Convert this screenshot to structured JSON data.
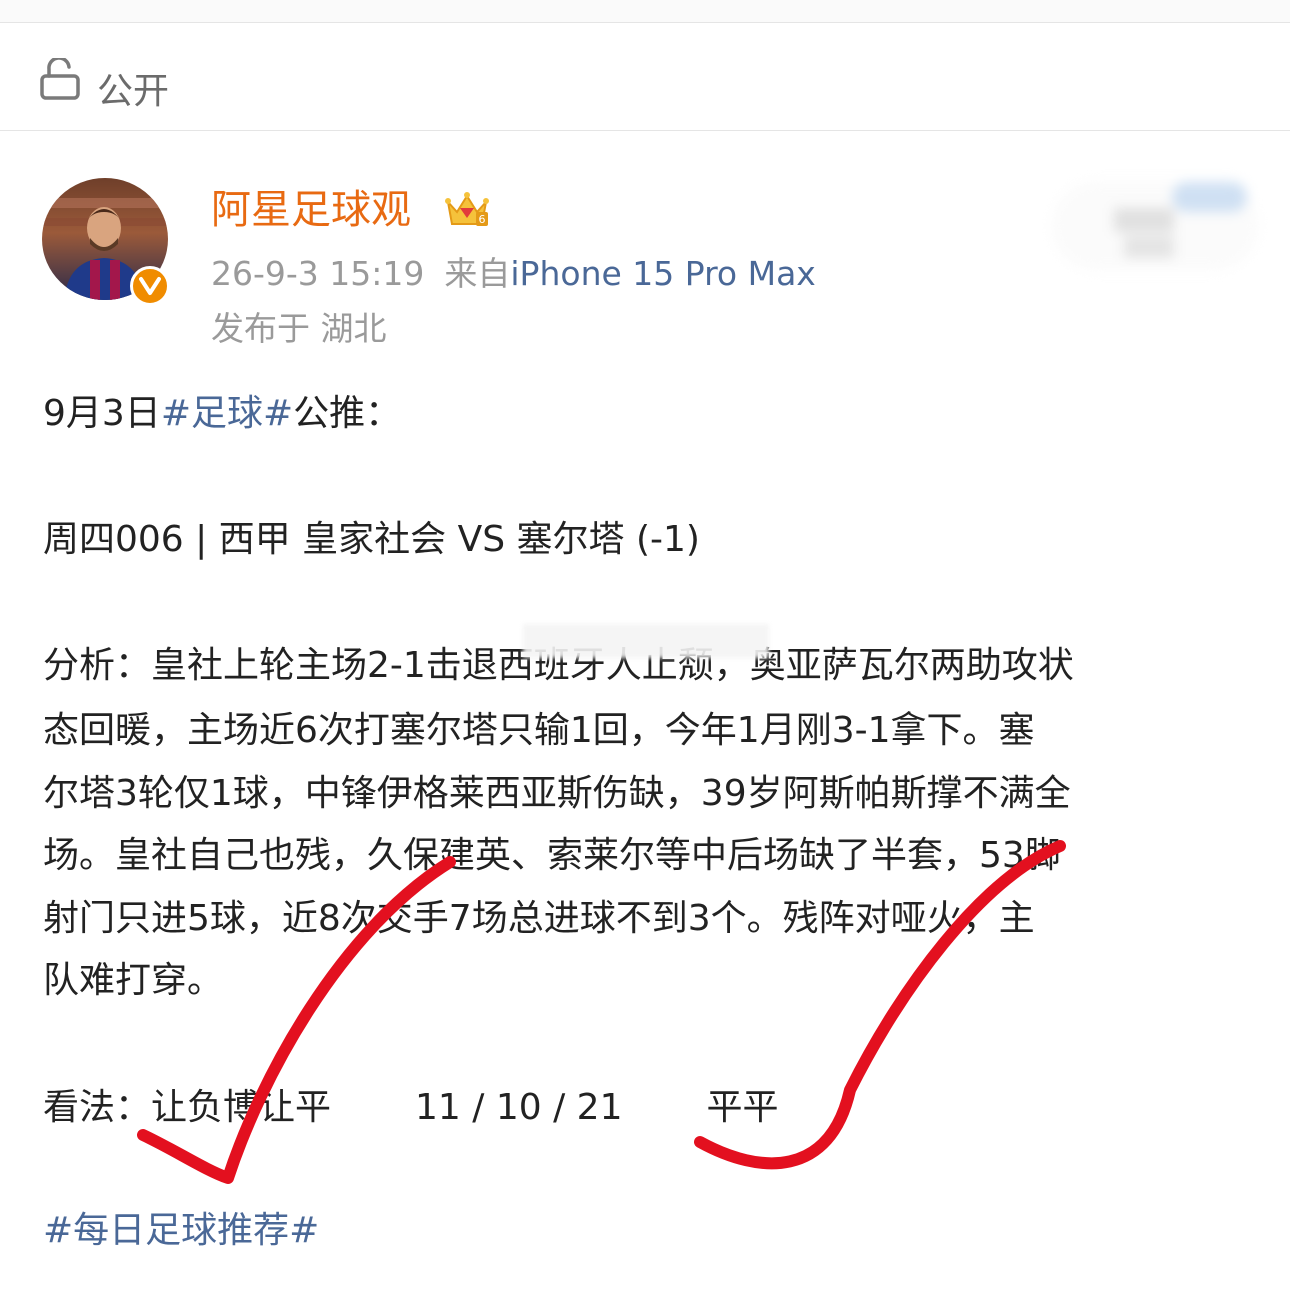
{
  "visibility": {
    "icon": "lock-open-icon",
    "label": "公开"
  },
  "post": {
    "author": {
      "name": "阿星足球观",
      "avatar": "avatar-photo",
      "badge": "verified-badge",
      "crown": "crown-icon"
    },
    "meta": {
      "timestamp": "26-9-3 15:19",
      "source_prefix": "来自",
      "device": "iPhone 15 Pro Max",
      "location": "发布于 湖北"
    },
    "body": {
      "date_prefix": "9月3日",
      "date_tag": "#足球#",
      "date_suffix": "公推：",
      "match_line": "周四006 | 西甲 皇家社会 VS 塞尔塔 (-1)",
      "analysis_lines": [
        "分析：皇社上轮主场2-1击退西班牙人止颓，奥亚萨瓦尔两助攻状",
        "态回暖，主场近6次打塞尔塔只输1回，今年1月刚3-1拿下。塞",
        "尔塔3轮仅1球，中锋伊格莱西亚斯伤缺，39岁阿斯帕斯撑不满全",
        "场。皇社自己也残，久保建英、索莱尔等中后场缺了半套，53脚",
        "射门只进5球，近8次交手7场总进球不到3个。残阵对哑火，主",
        "队难打穿。"
      ],
      "view_label": "看法：让负博让平",
      "view_odds": "11 / 10 / 21",
      "view_result": "平平",
      "footer_tag": "#每日足球推荐#"
    }
  },
  "colors": {
    "username": "#e86a12",
    "link": "#4a6897",
    "meta": "#9a9a9a",
    "checkmark": "#e3101f"
  }
}
